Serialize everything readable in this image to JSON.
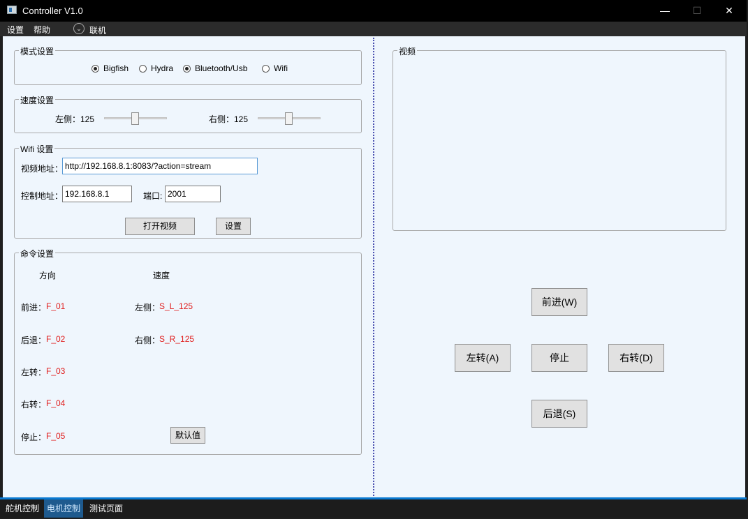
{
  "window": {
    "title": "Controller V1.0",
    "minimize": "—",
    "maximize": "☐",
    "close": "✕"
  },
  "menubar": {
    "items": [
      "设置",
      "帮助"
    ],
    "connect_label": "联机",
    "connect_icon": "chevron-down-circle-icon"
  },
  "mode_group": {
    "legend": "模式设置",
    "options": [
      {
        "label": "Bigfish",
        "checked": true
      },
      {
        "label": "Hydra",
        "checked": false
      },
      {
        "label": "Bluetooth/Usb",
        "checked": true
      },
      {
        "label": "Wifi",
        "checked": false
      }
    ]
  },
  "speed_group": {
    "legend": "速度设置",
    "left_label": "左侧：125",
    "right_label": "右侧：125",
    "left_value": 125,
    "right_value": 125
  },
  "wifi_group": {
    "legend": "Wifi 设置",
    "video_addr_label": "视频地址：",
    "video_addr_value": "http://192.168.8.1:8083/?action=stream",
    "control_addr_label": "控制地址：",
    "control_addr_value": "192.168.8.1",
    "port_label": "端口:",
    "port_value": "2001",
    "open_video_button": "打开视频",
    "set_button": "设置"
  },
  "command_group": {
    "legend": "命令设置",
    "direction_header": "方向",
    "speed_header": "速度",
    "directions": [
      {
        "label": "前进：",
        "code": "F_01"
      },
      {
        "label": "后退：",
        "code": "F_02"
      },
      {
        "label": "左转：",
        "code": "F_03"
      },
      {
        "label": "右转：",
        "code": "F_04"
      },
      {
        "label": "停止：",
        "code": "F_05"
      }
    ],
    "speeds": [
      {
        "label": "左侧：",
        "code": "S_L_125"
      },
      {
        "label": "右侧：",
        "code": "S_R_125"
      }
    ],
    "default_button": "默认值"
  },
  "video_group": {
    "legend": "视频"
  },
  "controls": {
    "forward": "前进(W)",
    "left": "左转(A)",
    "stop": "停止",
    "right": "右转(D)",
    "backward": "后退(S)"
  },
  "tabs": [
    {
      "label": "舵机控制",
      "active": false
    },
    {
      "label": "电机控制",
      "active": true
    },
    {
      "label": "测试页面",
      "active": false
    }
  ]
}
